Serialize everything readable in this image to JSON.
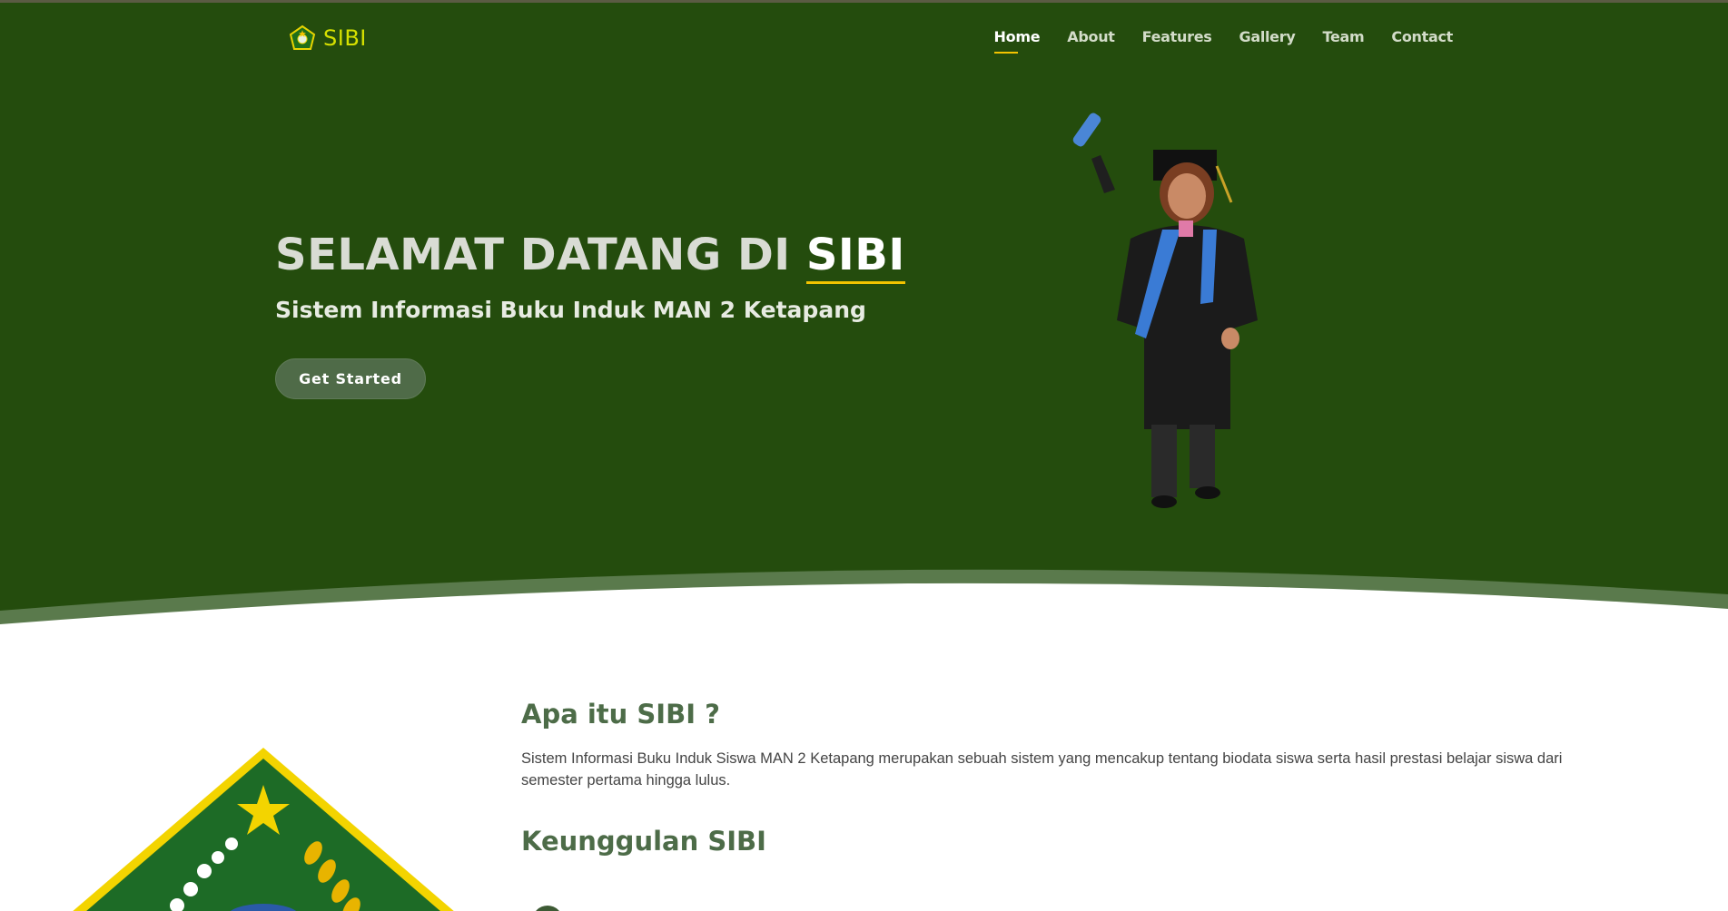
{
  "brand": {
    "name": "SIBI",
    "logo_icon": "madrasah-emblem-icon"
  },
  "nav": {
    "items": [
      {
        "label": "Home",
        "active": true
      },
      {
        "label": "About",
        "active": false
      },
      {
        "label": "Features",
        "active": false
      },
      {
        "label": "Gallery",
        "active": false
      },
      {
        "label": "Team",
        "active": false
      },
      {
        "label": "Contact",
        "active": false
      }
    ]
  },
  "hero": {
    "title_prefix": "SELAMAT DATANG DI ",
    "title_accent": "SIBI",
    "subtitle": "Sistem Informasi Buku Induk MAN 2 Ketapang",
    "cta_label": "Get Started",
    "illustration": "graduate-student-illustration"
  },
  "about": {
    "title": "Apa itu SIBI ?",
    "text": "Sistem Informasi Buku Induk Siswa MAN 2 Ketapang merupakan sebuah sistem yang mencakup tentang biodata siswa serta hasil prestasi belajar siswa dari semester pertama hingga lulus.",
    "advantages_title": "Keunggulan SIBI",
    "image": "kemenag-emblem-logo"
  },
  "colors": {
    "hero_bg": "#244c0d",
    "accent": "#f3c300",
    "heading": "#4d6c48",
    "brand": "#d6e000"
  }
}
